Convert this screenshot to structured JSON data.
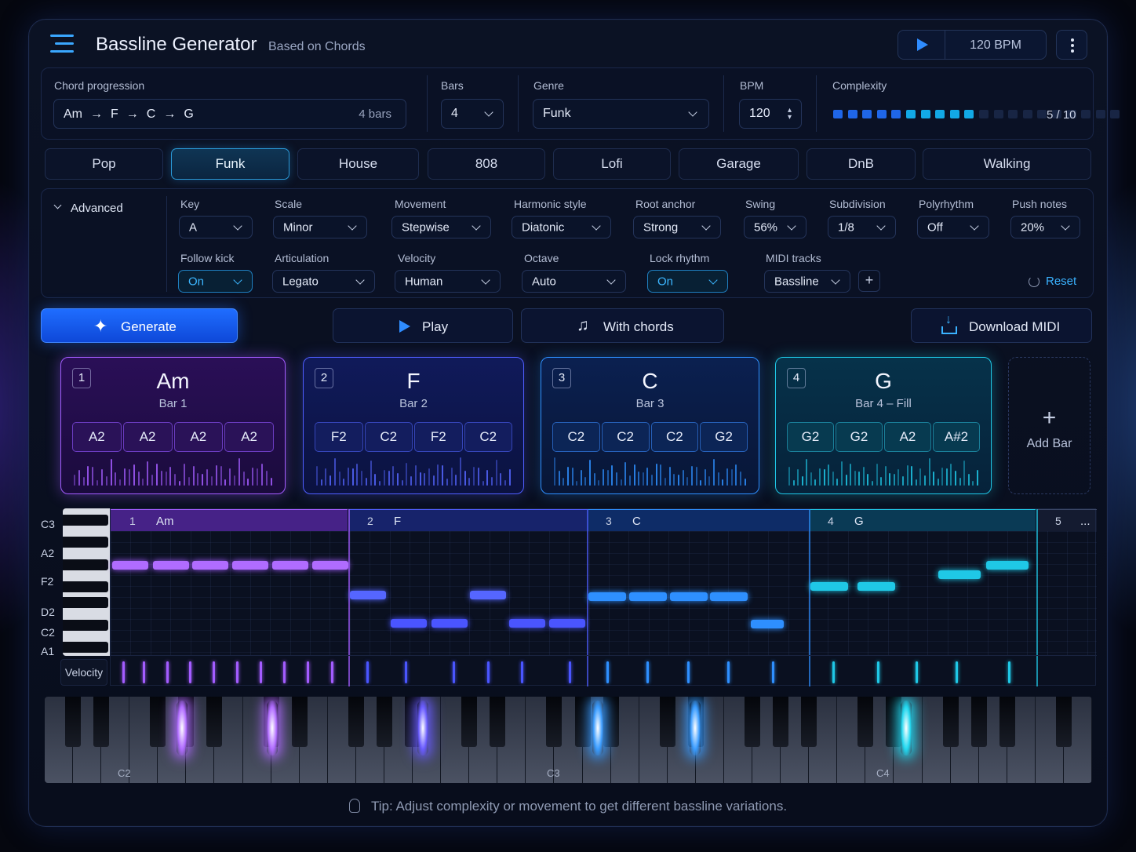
{
  "header": {
    "title": "Bassline Generator",
    "subtitle": "Based on Chords",
    "bpm_display": "120 BPM"
  },
  "settings": {
    "chord_progression": {
      "label": "Chord progression",
      "chords": [
        "Am",
        "F",
        "C",
        "G"
      ],
      "arrow": "→",
      "bars_note": "4 bars"
    },
    "bars": {
      "label": "Bars",
      "value": "4"
    },
    "genre": {
      "label": "Genre",
      "value": "Funk"
    },
    "bpm": {
      "label": "BPM",
      "value": "120"
    },
    "complexity": {
      "label": "Complexity",
      "value": 5,
      "max": 10,
      "display": "5 / 10"
    }
  },
  "genre_tabs": [
    {
      "label": "Pop",
      "active": false
    },
    {
      "label": "Funk",
      "active": true
    },
    {
      "label": "House",
      "active": false
    },
    {
      "label": "808",
      "active": false
    },
    {
      "label": "Lofi",
      "active": false
    },
    {
      "label": "Garage",
      "active": false
    },
    {
      "label": "DnB",
      "active": false
    },
    {
      "label": "Walking",
      "active": false
    }
  ],
  "advanced": {
    "toggle_label": "Advanced",
    "key": {
      "label": "Key",
      "value": "A"
    },
    "scale": {
      "label": "Scale",
      "value": "Minor"
    },
    "movement": {
      "label": "Movement",
      "value": "Stepwise"
    },
    "harmonic_style": {
      "label": "Harmonic style",
      "value": "Diatonic"
    },
    "root_anchor": {
      "label": "Root anchor",
      "value": "Strong"
    },
    "swing": {
      "label": "Swing",
      "value": "56%"
    },
    "subdivision": {
      "label": "Subdivision",
      "value": "1/8"
    },
    "polyrhythm": {
      "label": "Polyrhythm",
      "value": "Off"
    },
    "push_notes": {
      "label": "Push notes",
      "value": "20%"
    },
    "follow_kick": {
      "label": "Follow kick",
      "value": "On"
    },
    "articulation": {
      "label": "Articulation",
      "value": "Legato"
    },
    "velocity": {
      "label": "Velocity",
      "value": "Human"
    },
    "octave": {
      "label": "Octave",
      "value": "Auto"
    },
    "lock_rhythm": {
      "label": "Lock rhythm",
      "value": "On"
    },
    "midi_tracks": {
      "label": "MIDI tracks",
      "value": "Bassline"
    },
    "reset_label": "Reset"
  },
  "actions": {
    "generate": "Generate",
    "play": "Play",
    "with_chords": "With chords",
    "download": "Download MIDI"
  },
  "bars": [
    {
      "num": "1",
      "chord": "Am",
      "label": "Bar 1",
      "notes": [
        "A2",
        "A2",
        "A2",
        "A2"
      ],
      "color": "#a35cff"
    },
    {
      "num": "2",
      "chord": "F",
      "label": "Bar 2",
      "notes": [
        "F2",
        "C2",
        "F2",
        "C2"
      ],
      "color": "#5566ff"
    },
    {
      "num": "3",
      "chord": "C",
      "label": "Bar 3",
      "notes": [
        "C2",
        "C2",
        "C2",
        "G2"
      ],
      "color": "#2e8fff"
    },
    {
      "num": "4",
      "chord": "G",
      "label": "Bar 4 – Fill",
      "notes": [
        "G2",
        "G2",
        "A2",
        "A#2"
      ],
      "color": "#1fc8e6"
    }
  ],
  "add_bar_label": "Add Bar",
  "piano_roll": {
    "pitch_labels": [
      "C3",
      "A2",
      "F2",
      "D2",
      "C2",
      "A1"
    ],
    "velocity_label": "Velocity",
    "headers": [
      {
        "num": "1",
        "chord": "Am"
      },
      {
        "num": "2",
        "chord": "F"
      },
      {
        "num": "3",
        "chord": "C"
      },
      {
        "num": "4",
        "chord": "G"
      },
      {
        "num": "5",
        "chord": "..."
      }
    ]
  },
  "keyboard": {
    "labels": [
      "C2",
      "C3",
      "C4"
    ]
  },
  "tip": "Tip: Adjust complexity or movement to get different bassline variations."
}
